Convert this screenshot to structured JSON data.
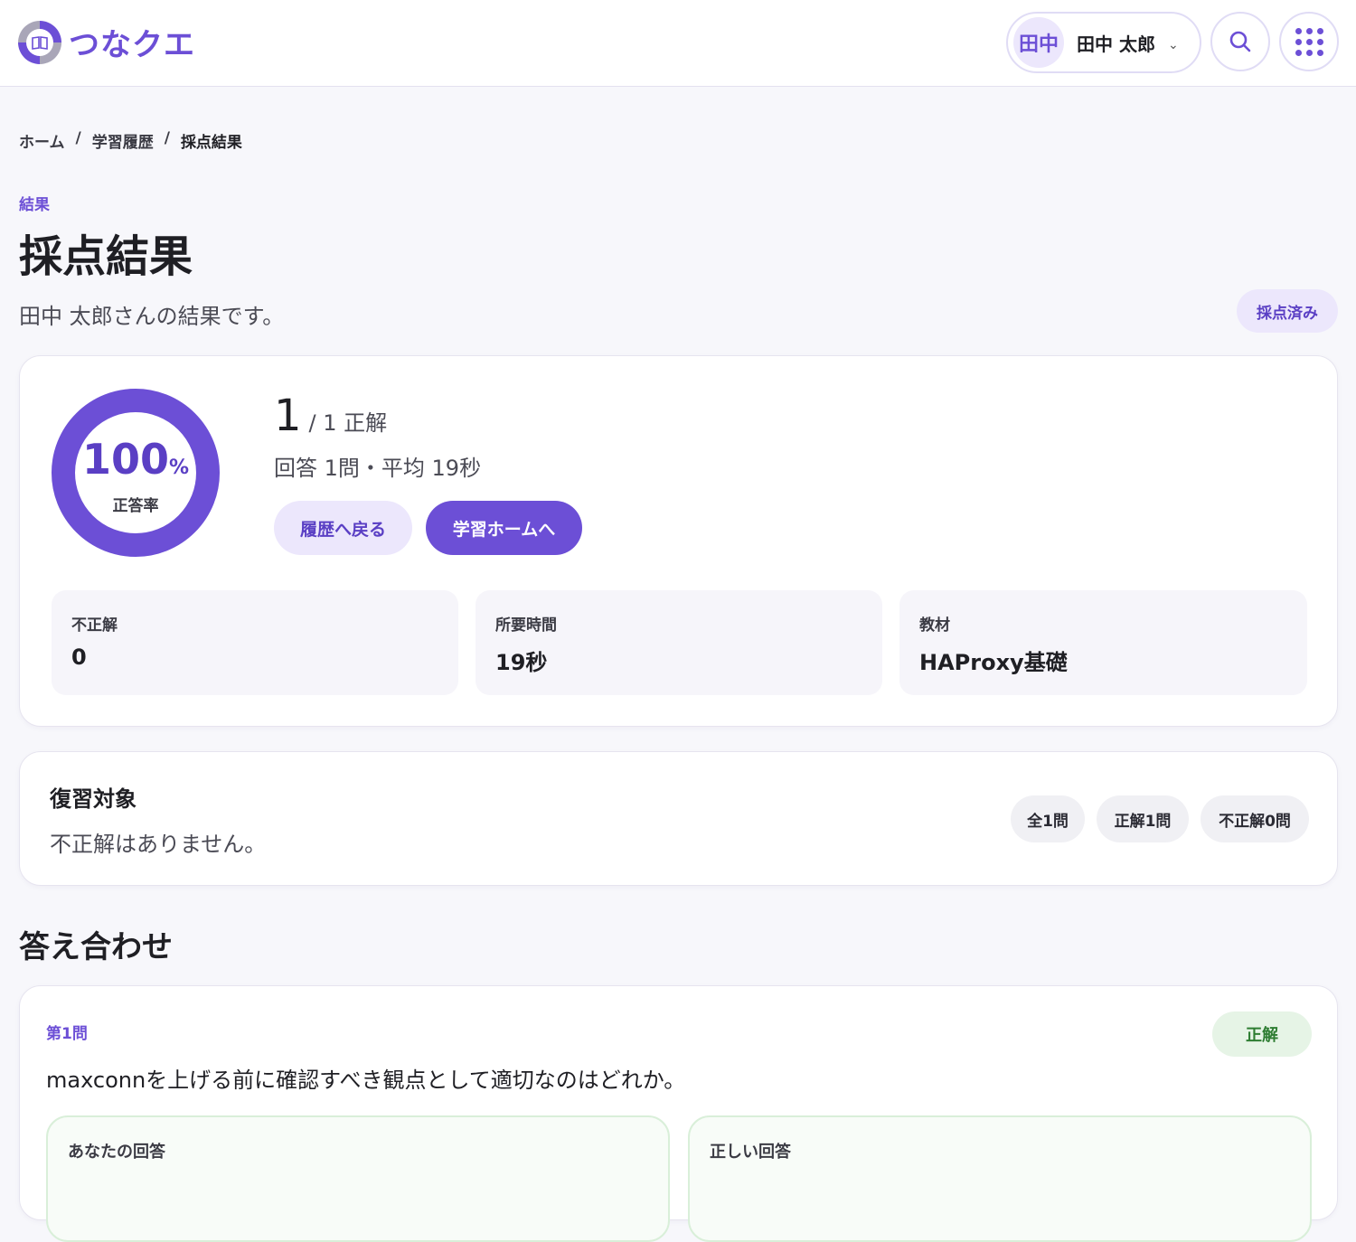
{
  "header": {
    "logo_text": "つなクエ",
    "user": {
      "avatar_text": "田中",
      "name": "田中 太郎"
    }
  },
  "breadcrumb": [
    "ホーム",
    "学習履歴",
    "採点結果"
  ],
  "breadcrumb_sep": "/",
  "page": {
    "eyebrow": "結果",
    "title": "採点結果",
    "subtitle": "田中 太郎さんの結果です。",
    "status_badge": "採点済み"
  },
  "summary": {
    "accuracy_value": "100",
    "accuracy_unit": "%",
    "accuracy_fraction": 1.0,
    "accuracy_label": "正答率",
    "score_correct": "1",
    "score_rest": "/ 1 正解",
    "meta": "回答 1問・平均 19秒",
    "back_button": "履歴へ戻る",
    "home_button": "学習ホームへ",
    "stats": [
      {
        "label": "不正解",
        "value": "0"
      },
      {
        "label": "所要時間",
        "value": "19秒"
      },
      {
        "label": "教材",
        "value": "HAProxy基礎"
      }
    ]
  },
  "review": {
    "title": "復習対象",
    "message": "不正解はありません。",
    "chips": [
      "全1問",
      "正解1問",
      "不正解0問"
    ]
  },
  "answers": {
    "section_title": "答え合わせ",
    "questions": [
      {
        "number": "第1問",
        "text": "maxconnを上げる前に確認すべき観点として適切なのはどれか。",
        "result": "正解",
        "your_answer_label": "あなたの回答",
        "correct_answer_label": "正しい回答"
      }
    ]
  },
  "colors": {
    "accent": "#6c4fd6",
    "accent_light": "#ece7fc",
    "success": "#2e7d32",
    "success_bg": "#e6f4e6"
  },
  "icons": [
    "logo-icon",
    "chevron-down-icon",
    "search-icon",
    "apps-grid-icon"
  ]
}
